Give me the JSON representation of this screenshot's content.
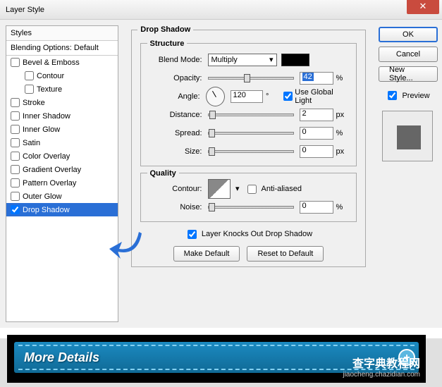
{
  "window": {
    "title": "Layer Style"
  },
  "styles": {
    "header": "Styles",
    "blending": "Blending Options: Default",
    "items": [
      {
        "label": "Bevel & Emboss",
        "checked": false,
        "sub": false
      },
      {
        "label": "Contour",
        "checked": false,
        "sub": true
      },
      {
        "label": "Texture",
        "checked": false,
        "sub": true
      },
      {
        "label": "Stroke",
        "checked": false,
        "sub": false
      },
      {
        "label": "Inner Shadow",
        "checked": false,
        "sub": false
      },
      {
        "label": "Inner Glow",
        "checked": false,
        "sub": false
      },
      {
        "label": "Satin",
        "checked": false,
        "sub": false
      },
      {
        "label": "Color Overlay",
        "checked": false,
        "sub": false
      },
      {
        "label": "Gradient Overlay",
        "checked": false,
        "sub": false
      },
      {
        "label": "Pattern Overlay",
        "checked": false,
        "sub": false
      },
      {
        "label": "Outer Glow",
        "checked": false,
        "sub": false
      },
      {
        "label": "Drop Shadow",
        "checked": true,
        "sub": false,
        "selected": true
      }
    ]
  },
  "panel": {
    "title": "Drop Shadow",
    "structure": {
      "legend": "Structure",
      "blendModeLabel": "Blend Mode:",
      "blendMode": "Multiply",
      "color": "#000000",
      "opacityLabel": "Opacity:",
      "opacity": "42",
      "opacityUnit": "%",
      "angleLabel": "Angle:",
      "angle": "120",
      "angleUnit": "°",
      "globalLightLabel": "Use Global Light",
      "globalLight": true,
      "distanceLabel": "Distance:",
      "distance": "2",
      "distanceUnit": "px",
      "spreadLabel": "Spread:",
      "spread": "0",
      "spreadUnit": "%",
      "sizeLabel": "Size:",
      "size": "0",
      "sizeUnit": "px"
    },
    "quality": {
      "legend": "Quality",
      "contourLabel": "Contour:",
      "antiAliasedLabel": "Anti-aliased",
      "antiAliased": false,
      "noiseLabel": "Noise:",
      "noise": "0",
      "noiseUnit": "%"
    },
    "knockoutLabel": "Layer Knocks Out Drop Shadow",
    "knockout": true,
    "makeDefault": "Make Default",
    "resetDefault": "Reset to Default"
  },
  "actions": {
    "ok": "OK",
    "cancel": "Cancel",
    "newStyle": "New Style...",
    "previewLabel": "Preview",
    "preview": true
  },
  "banner": {
    "text": "More Details"
  },
  "watermark": {
    "line1": "查字典教程网",
    "line2": "jiaocheng.chazidian.com"
  }
}
